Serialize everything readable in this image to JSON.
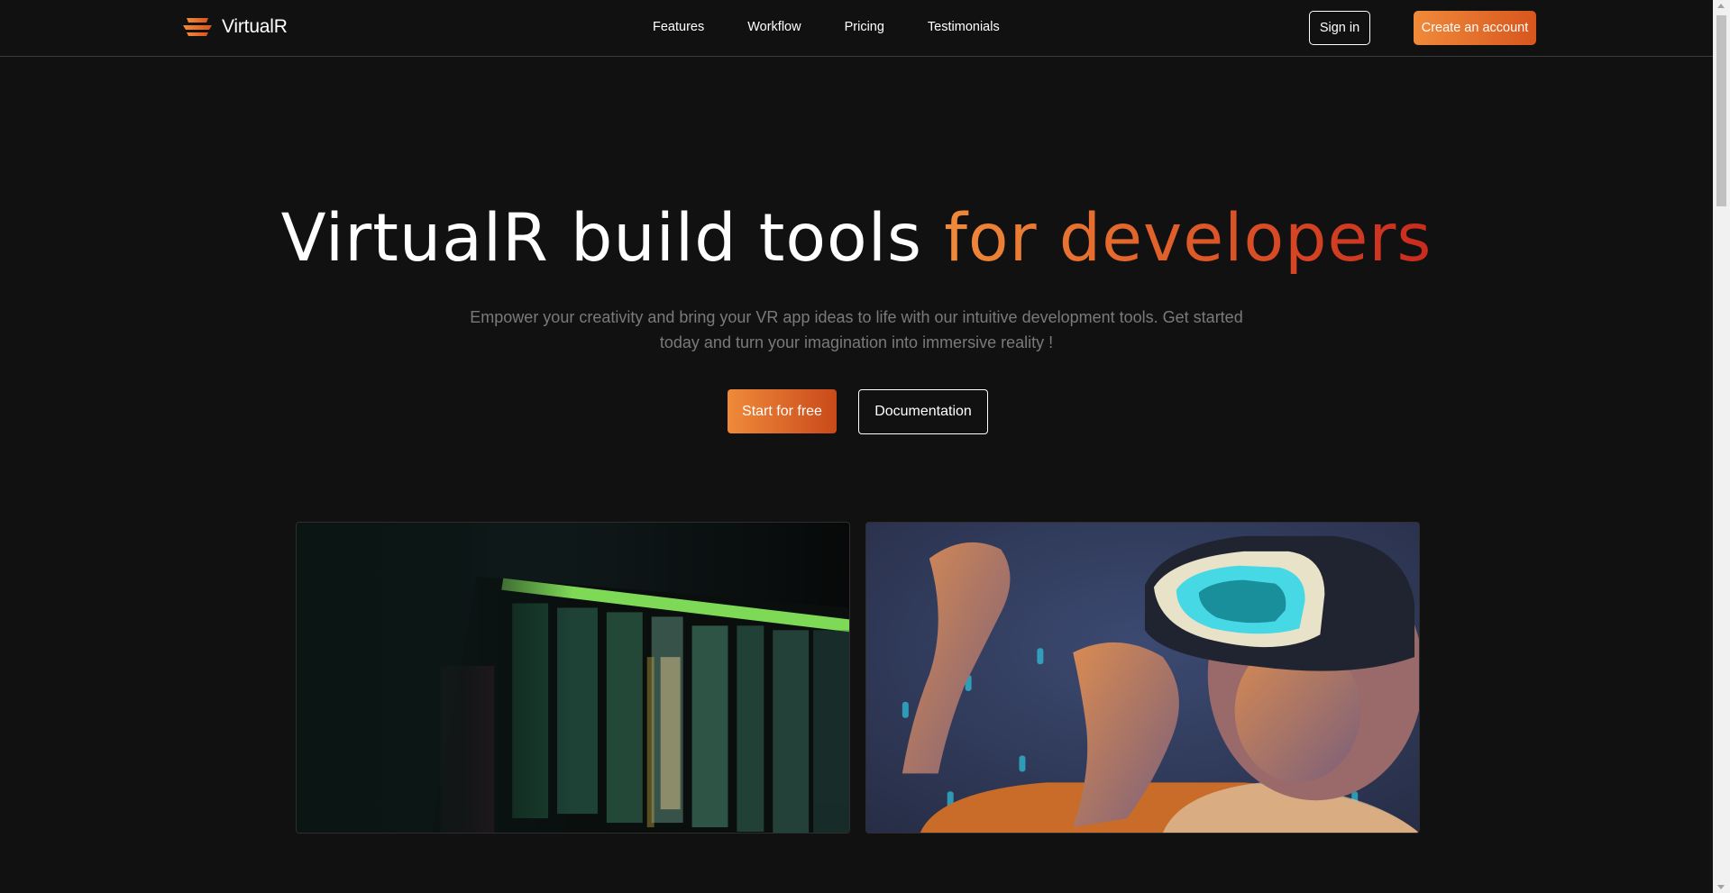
{
  "brand": {
    "name": "VirtualR"
  },
  "nav": {
    "links": [
      "Features",
      "Workflow",
      "Pricing",
      "Testimonials"
    ],
    "signin_label": "Sign in",
    "create_label": "Create an account"
  },
  "hero": {
    "title_plain": "VirtualR build tools ",
    "title_accent": "for developers",
    "subtitle": "Empower your creativity and bring your VR app ideas to life with our intuitive development tools. Get started today and turn your imagination into immersive reality !",
    "primary_cta": "Start for free",
    "secondary_cta": "Documentation"
  },
  "images": [
    {
      "name": "code-terminal-image",
      "icon": "terminal-photo"
    },
    {
      "name": "vr-headset-image",
      "icon": "vr-headset-photo"
    }
  ],
  "colors": {
    "background": "#111111",
    "accent_start": "#f08a3a",
    "accent_end": "#c92a1e",
    "muted_text": "#7a7a7a"
  }
}
